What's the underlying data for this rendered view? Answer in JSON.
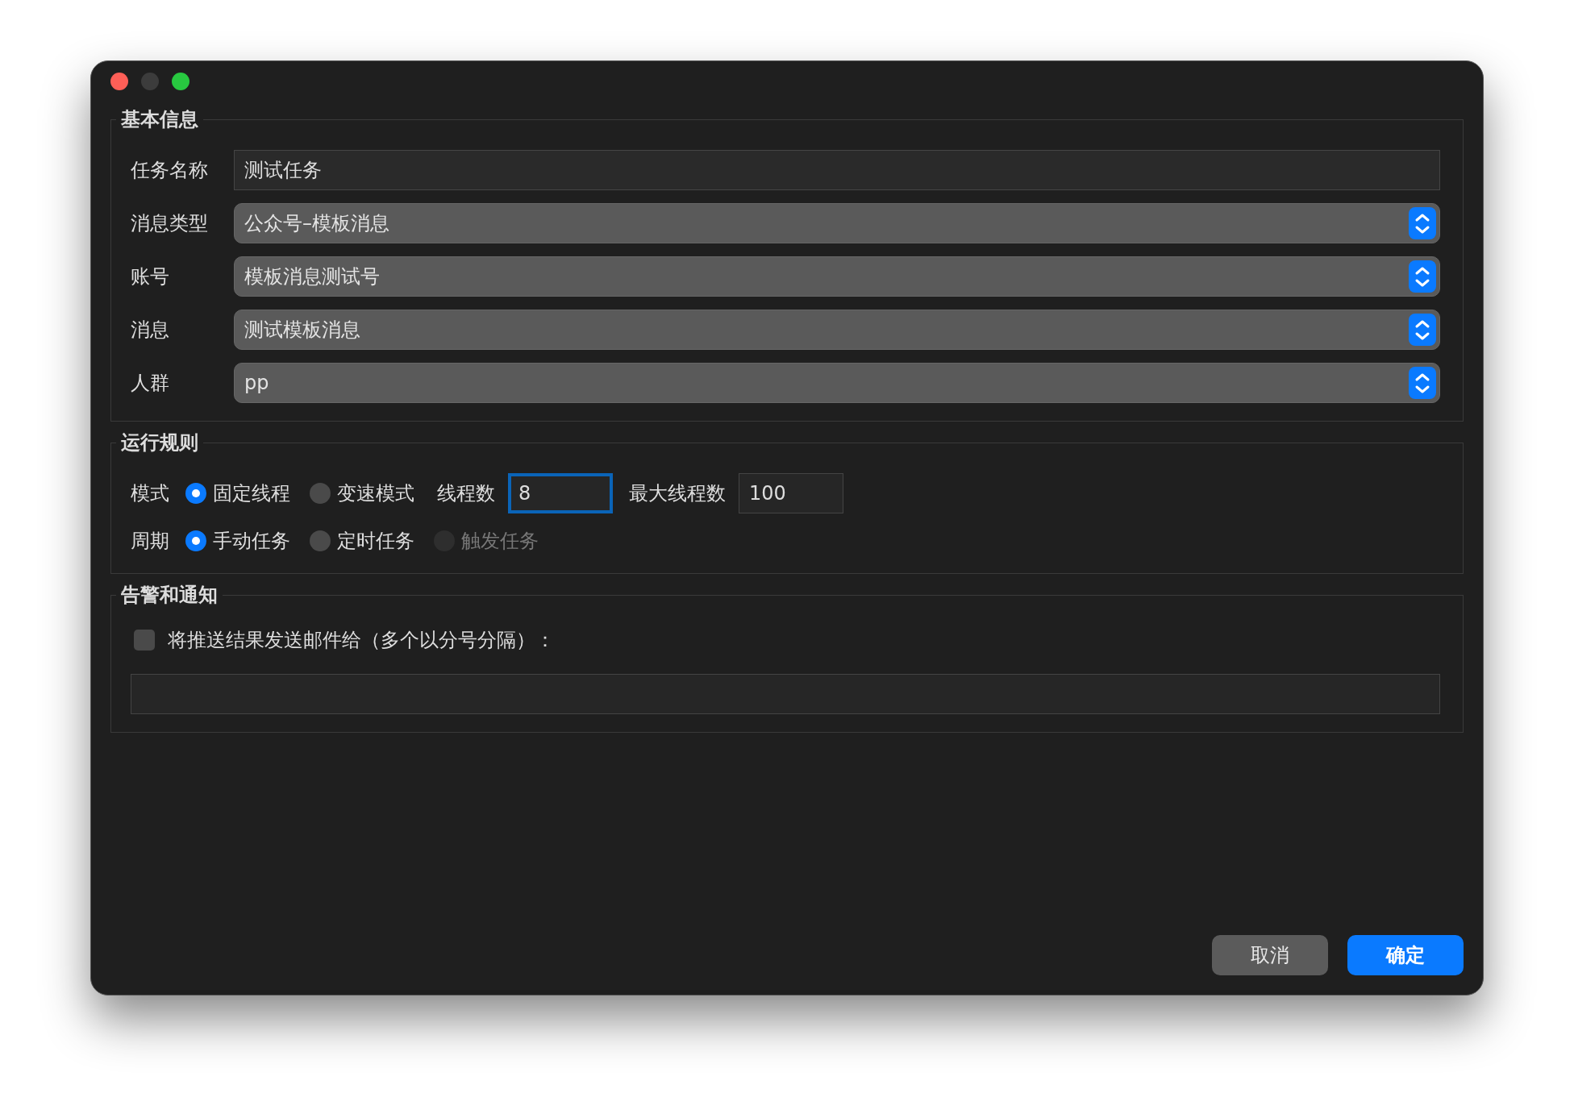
{
  "window": {
    "controls": [
      {
        "kind": "close",
        "disabled": false
      },
      {
        "kind": "minimize",
        "disabled": true
      },
      {
        "kind": "zoom",
        "disabled": false
      }
    ]
  },
  "basic_info": {
    "title": "基本信息",
    "fields": [
      {
        "kind": "text",
        "label": "任务名称",
        "value": "测试任务"
      },
      {
        "kind": "select",
        "label": "消息类型",
        "value": "公众号–模板消息"
      },
      {
        "kind": "select",
        "label": "账号",
        "value": "模板消息测试号"
      },
      {
        "kind": "select",
        "label": "消息",
        "value": "测试模板消息"
      },
      {
        "kind": "select",
        "label": "人群",
        "value": "pp"
      }
    ]
  },
  "run_rules": {
    "title": "运行规则",
    "rows": [
      {
        "label": "模式",
        "options": [
          {
            "label": "固定线程",
            "selected": true,
            "disabled": false
          },
          {
            "label": "变速模式",
            "selected": false,
            "disabled": false
          }
        ],
        "inputs": [
          {
            "label": "线程数",
            "value": "8",
            "focused": true
          },
          {
            "label": "最大线程数",
            "value": "100",
            "focused": false
          }
        ]
      },
      {
        "label": "周期",
        "options": [
          {
            "label": "手动任务",
            "selected": true,
            "disabled": false
          },
          {
            "label": "定时任务",
            "selected": false,
            "disabled": false
          },
          {
            "label": "触发任务",
            "selected": false,
            "disabled": true
          }
        ]
      }
    ]
  },
  "notification": {
    "title": "告警和通知",
    "checkbox": {
      "label": "将推送结果发送邮件给（多个以分号分隔）：",
      "checked": false
    }
  },
  "buttons": [
    {
      "label": "取消",
      "kind": "secondary"
    },
    {
      "label": "确定",
      "kind": "primary"
    }
  ]
}
